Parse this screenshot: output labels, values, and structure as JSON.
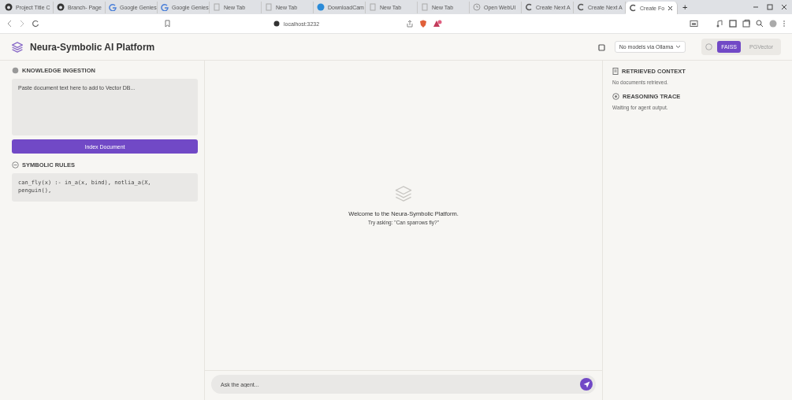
{
  "browser": {
    "tabs": [
      {
        "title": "Project Title C",
        "kind": "github",
        "selected": false
      },
      {
        "title": "Branch- Page",
        "kind": "github",
        "selected": false
      },
      {
        "title": "Google Genies",
        "kind": "g",
        "selected": false
      },
      {
        "title": "Google Genies",
        "kind": "g",
        "selected": false
      },
      {
        "title": "New Tab",
        "kind": "page",
        "selected": false
      },
      {
        "title": "New Tab",
        "kind": "page",
        "selected": false
      },
      {
        "title": "DownloadCam",
        "kind": "circle",
        "selected": false
      },
      {
        "title": "New Tab",
        "kind": "page",
        "selected": false
      },
      {
        "title": "New Tab",
        "kind": "page",
        "selected": false
      },
      {
        "title": "Open WebUI",
        "kind": "clock",
        "selected": false
      },
      {
        "title": "Create Next A",
        "kind": "c",
        "selected": false
      },
      {
        "title": "Create Next A",
        "kind": "c",
        "selected": false
      },
      {
        "title": "Create Fo",
        "kind": "c",
        "selected": true
      }
    ],
    "new_tab": "+",
    "address": "localhost:3232"
  },
  "app": {
    "title": "Neura-Symbolic AI Platform",
    "model_select": {
      "value": "No models via Ollama"
    },
    "vector_store": [
      {
        "label": "FAISS",
        "selected": true
      },
      {
        "label": "PGVector",
        "selected": false
      }
    ]
  },
  "left": {
    "ingestion": {
      "heading": "KNOWLEDGE INGESTION",
      "placeholder": "Paste document text here to add to Vector DB...",
      "button": "Index Document"
    },
    "rules": {
      "heading": "SYMBOLIC RULES",
      "code": "can_fly(x) :- in_a(x, bind), notlia_a(X,\npenguin(),"
    }
  },
  "chat": {
    "welcome": "Welcome to the Neura-Symbolic Platform.",
    "hint": "Try asking: \"Can sparrows fly?\"",
    "input": {
      "placeholder": "Ask the agent..."
    }
  },
  "right": {
    "sections": [
      {
        "kind": "context",
        "heading": "RETRIEVED CONTEXT",
        "text": "No documents retrieved."
      },
      {
        "kind": "trace",
        "heading": "REASONING TRACE",
        "text": "Waiting for agent output."
      }
    ]
  }
}
